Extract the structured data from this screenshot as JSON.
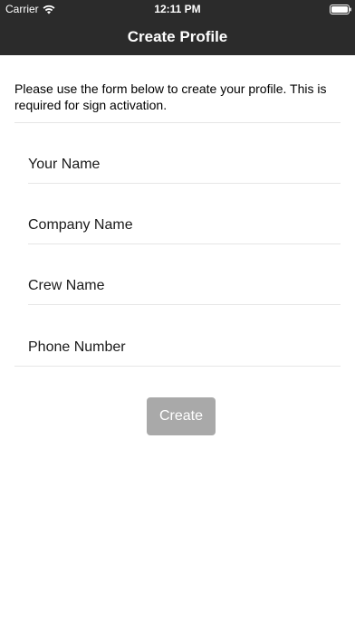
{
  "status_bar": {
    "carrier": "Carrier",
    "time": "12:11 PM",
    "wifi_icon": "wifi-icon",
    "battery_icon": "battery-icon"
  },
  "nav": {
    "title": "Create Profile"
  },
  "intro": {
    "text": "Please use the form below to create your profile. This is required for sign activation."
  },
  "form": {
    "your_name_placeholder": "Your Name",
    "company_name_placeholder": "Company Name",
    "crew_name_placeholder": "Crew Name",
    "phone_number_placeholder": "Phone Number"
  },
  "create_button": {
    "label": "Create",
    "state": "disabled"
  },
  "colors": {
    "bar_background": "#2b2b2b",
    "button_disabled": "#a9a9a9",
    "divider": "#e6e6e6"
  }
}
